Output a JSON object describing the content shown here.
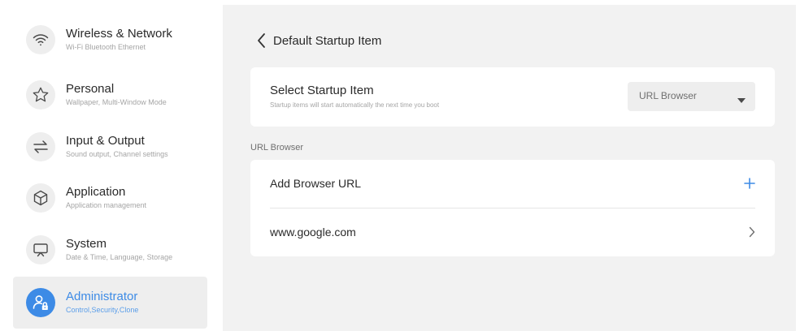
{
  "sidebar": {
    "items": [
      {
        "title": "Wireless & Network",
        "subtitle": "Wi-Fi Bluetooth Ethernet",
        "icon": "wifi-icon",
        "active": false
      },
      {
        "title": "Personal",
        "subtitle": "Wallpaper, Multi-Window Mode",
        "icon": "star-icon",
        "active": false
      },
      {
        "title": "Input & Output",
        "subtitle": "Sound output, Channel settings",
        "icon": "swap-arrows-icon",
        "active": false
      },
      {
        "title": "Application",
        "subtitle": "Application management",
        "icon": "cube-icon",
        "active": false
      },
      {
        "title": "System",
        "subtitle": "Date & Time, Language, Storage",
        "icon": "monitor-icon",
        "active": false
      },
      {
        "title": "Administrator",
        "subtitle": "Control,Security,Clone",
        "icon": "admin-user-lock-icon",
        "active": true
      }
    ]
  },
  "page": {
    "title": "Default Startup Item",
    "back_icon": "chevron-left-icon"
  },
  "startup": {
    "title": "Select Startup Item",
    "description": "Startup items will start automatically the next time you boot",
    "selected": "URL Browser"
  },
  "url_browser": {
    "section_label": "URL Browser",
    "add_label": "Add Browser URL",
    "urls": [
      "www.google.com"
    ]
  },
  "colors": {
    "accent": "#3d8be6",
    "content_background": "#f2f2f2",
    "card_background": "#ffffff"
  }
}
